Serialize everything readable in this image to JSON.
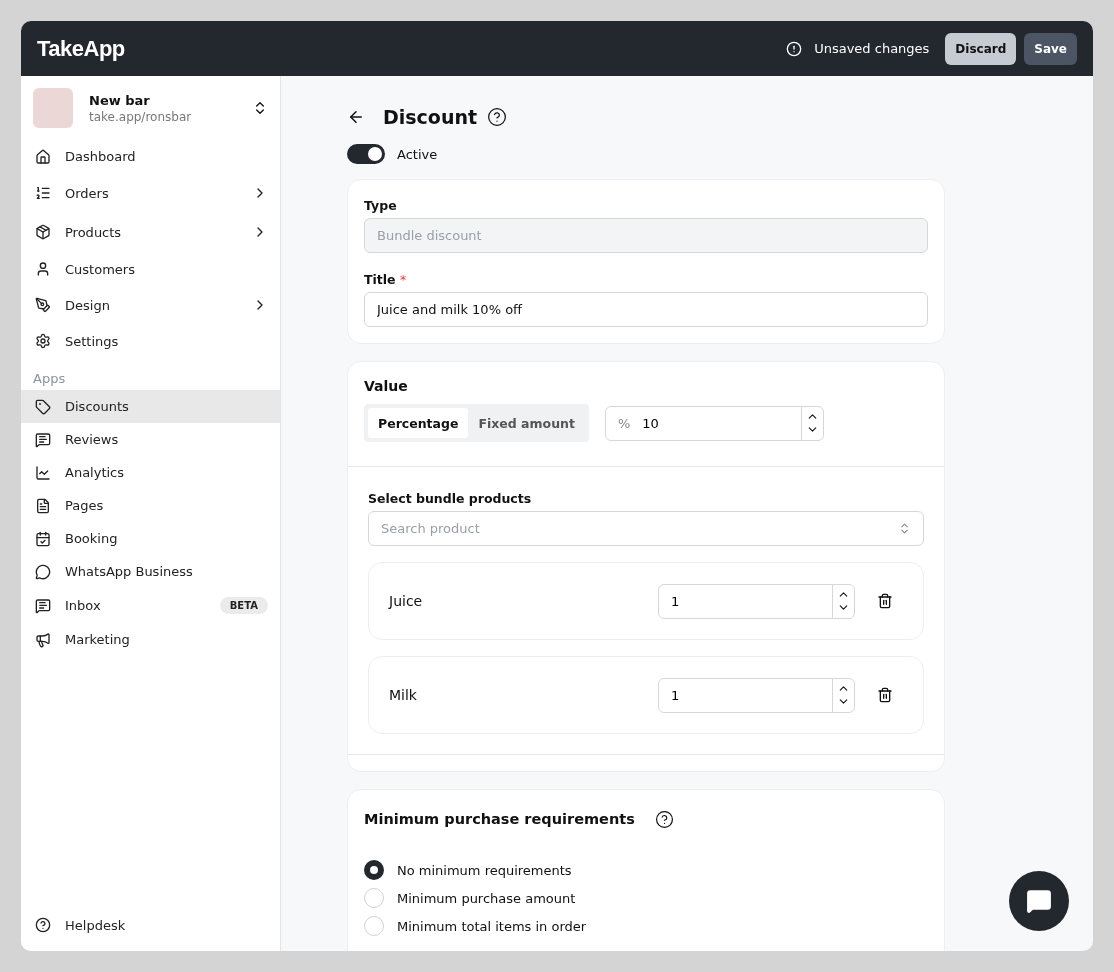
{
  "header": {
    "logo": "TakeApp",
    "status": "Unsaved changes",
    "buttons": [
      "Discard",
      "Save"
    ]
  },
  "store": {
    "name": "New bar",
    "url": "take.app/ronsbar"
  },
  "sidebar": {
    "items": [
      {
        "label": "Dashboard",
        "expandable": false,
        "selected": false
      },
      {
        "label": "Orders",
        "expandable": true,
        "selected": false
      },
      {
        "label": "Products",
        "expandable": true,
        "selected": false
      },
      {
        "label": "Customers",
        "expandable": false,
        "selected": false
      },
      {
        "label": "Design",
        "expandable": true,
        "selected": false
      },
      {
        "label": "Settings",
        "expandable": false,
        "selected": false
      }
    ],
    "section": "Apps",
    "apps": [
      {
        "label": "Discounts",
        "selected": true
      },
      {
        "label": "Reviews",
        "selected": false
      },
      {
        "label": "Analytics",
        "selected": false
      },
      {
        "label": "Pages",
        "selected": false
      },
      {
        "label": "Booking",
        "selected": false
      },
      {
        "label": "WhatsApp Business",
        "selected": false
      },
      {
        "label": "Inbox",
        "selected": false,
        "badge": "BETA"
      },
      {
        "label": "Marketing",
        "selected": false
      }
    ],
    "footer": "Helpdesk"
  },
  "page": {
    "title": "Discount",
    "active": {
      "label": "Active",
      "on": true
    }
  },
  "details": {
    "type_label": "Type",
    "type_value": "Bundle discount",
    "title_label": "Title",
    "required_mark": "*",
    "title_value": "Juice and milk 10% off"
  },
  "value": {
    "heading": "Value",
    "modes": [
      {
        "label": "Percentage",
        "selected": true
      },
      {
        "label": "Fixed amount",
        "selected": false
      }
    ],
    "unit": "%",
    "amount": "10",
    "bundle_label": "Select bundle products",
    "search_placeholder": "Search product",
    "products": [
      {
        "name": "Juice",
        "quantity": "1"
      },
      {
        "name": "Milk",
        "quantity": "1"
      }
    ]
  },
  "minimum": {
    "heading": "Minimum purchase requirements",
    "options": [
      {
        "label": "No minimum requirements",
        "selected": true
      },
      {
        "label": "Minimum purchase amount",
        "selected": false
      },
      {
        "label": "Minimum total items in order",
        "selected": false
      }
    ]
  }
}
